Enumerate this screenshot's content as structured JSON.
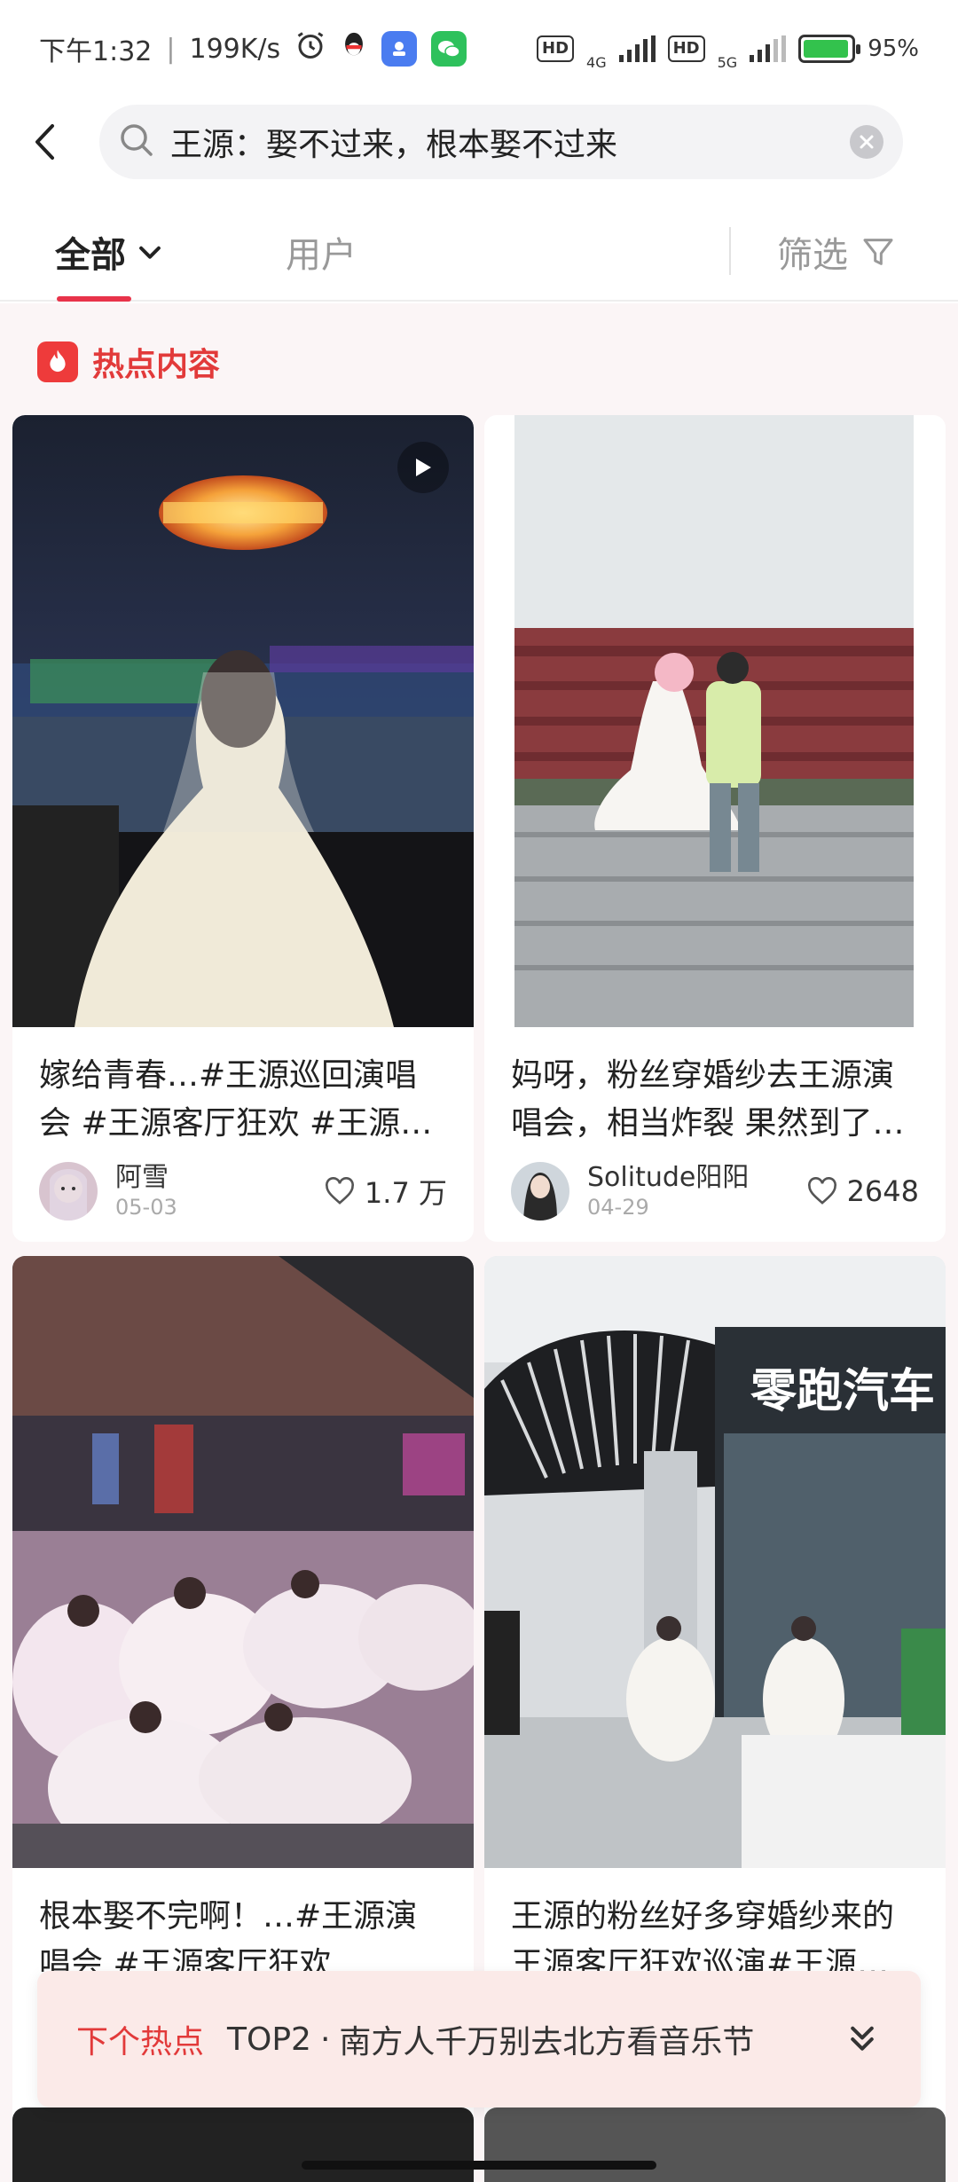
{
  "status_bar": {
    "time": "下午1:32",
    "speed": "199K/s",
    "hd1": "HD",
    "net1": "4G",
    "hd2": "HD",
    "net2": "5G",
    "battery": "95%",
    "battery_level": 0.95,
    "battery_color": "#33c24d"
  },
  "search": {
    "query": "王源：娶不过来，根本娶不过来"
  },
  "tabs": {
    "all": "全部",
    "users": "用户",
    "filter": "筛选",
    "accent": "#e8334a"
  },
  "hot_section": {
    "title": "热点内容",
    "cards": [
      {
        "title": "嫁给青春…#王源巡回演唱会 #王源客厅狂欢 #王源…",
        "author": "阿雪",
        "date": "05-03",
        "likes": "1.7 万",
        "has_play_icon": true
      },
      {
        "title": "妈呀，粉丝穿婚纱去王源演唱会，相当炸裂 果然到了…",
        "author": "Solitude阳阳",
        "date": "04-29",
        "likes": "2648",
        "has_play_icon": false
      },
      {
        "title": "根本娶不完啊！…#王源演唱会 #王源客厅狂欢",
        "author": "",
        "date": "",
        "likes": ""
      },
      {
        "title": "王源的粉丝好多穿婚纱来的王源客厅狂欢巡演#王源…",
        "author": "",
        "date": "",
        "likes": ""
      }
    ],
    "store_sign": "零跑汽车"
  },
  "next_hot": {
    "label": "下个热点",
    "rank": "TOP2",
    "separator": "·",
    "text": "南方人千万别去北方看音乐节"
  }
}
